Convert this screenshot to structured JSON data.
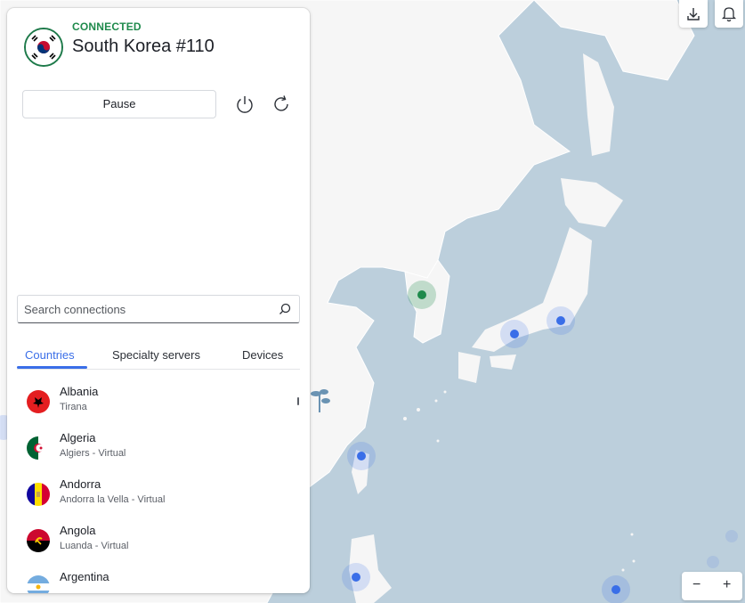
{
  "connection": {
    "status": "CONNECTED",
    "server_name": "South Korea #110",
    "flag_icon": "south-korea-flag-icon"
  },
  "controls": {
    "pause_label": "Pause",
    "power_icon": "power-icon",
    "refresh_icon": "refresh-icon"
  },
  "search": {
    "placeholder": "Search connections",
    "icon": "search-icon"
  },
  "tabs": [
    {
      "label": "Countries",
      "active": true
    },
    {
      "label": "Specialty servers",
      "active": false
    },
    {
      "label": "Devices",
      "active": false
    }
  ],
  "countries": [
    {
      "name": "Albania",
      "city": "Tirana",
      "flag_icon": "albania-flag-icon"
    },
    {
      "name": "Algeria",
      "city": "Algiers - Virtual",
      "flag_icon": "algeria-flag-icon"
    },
    {
      "name": "Andorra",
      "city": "Andorra la Vella - Virtual",
      "flag_icon": "andorra-flag-icon"
    },
    {
      "name": "Angola",
      "city": "Luanda - Virtual",
      "flag_icon": "angola-flag-icon"
    },
    {
      "name": "Argentina",
      "city": "",
      "flag_icon": "argentina-flag-icon"
    }
  ],
  "map": {
    "zoom_out": "−",
    "zoom_in": "+",
    "download_icon": "download-icon",
    "notification_icon": "bell-icon",
    "colors": {
      "sea": "#bccfdc",
      "land": "#f6f6f6",
      "border": "#ffffff",
      "connected": "#1f8a4c",
      "server": "#3a6ee8"
    }
  }
}
